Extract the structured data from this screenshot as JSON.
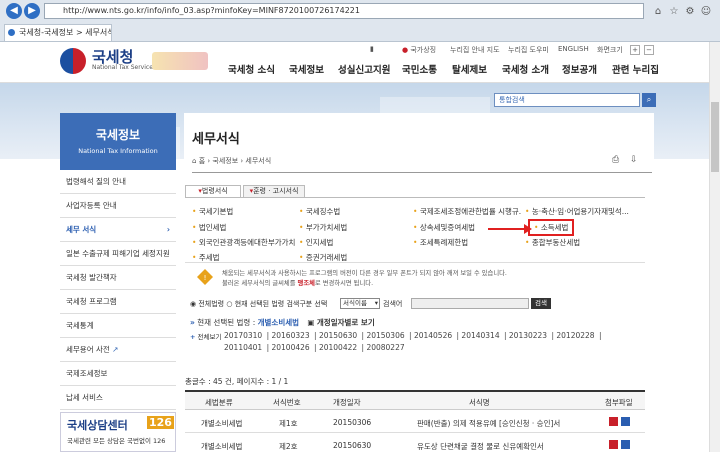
{
  "browser": {
    "url": "http://www.nts.go.kr/info/info_03.asp?minfoKey=MINF8720100726174221",
    "tab_title": "국세청-국세정보 > 세무서식..."
  },
  "header": {
    "logo_text": "국세청",
    "logo_sub": "National Tax Service",
    "util": [
      "국가상징",
      "누리집 안내 지도",
      "누리집 도우미",
      "ENGLISH",
      "화면크기"
    ],
    "zoom_plus": "+",
    "zoom_minus": "−",
    "gnb": [
      "국세청 소식",
      "국세정보",
      "성실신고지원",
      "국민소통",
      "탈세제보",
      "국세청 소개",
      "정보공개",
      "관련 누리집"
    ]
  },
  "search": {
    "placeholder": "통합검색"
  },
  "sidebar": {
    "title": "국세정보",
    "subtitle": "National Tax Information",
    "items": [
      {
        "label": "법령해석 질의 안내"
      },
      {
        "label": "사업자등록 안내"
      },
      {
        "label": "세무 서식"
      },
      {
        "label": "일본 수출규제 피해기업 세정지원"
      },
      {
        "label": "국세청 발간책자"
      },
      {
        "label": "국세청 프로그램"
      },
      {
        "label": "국세통계"
      },
      {
        "label": "세무용어 사전"
      },
      {
        "label": "국제조세정보"
      },
      {
        "label": "납세 서비스"
      }
    ],
    "banner_title": "국세상담센터",
    "banner_num": "126",
    "banner_sub": "국세관련 모든 상담은 국번없이 126"
  },
  "page": {
    "title": "세무서식",
    "breadcrumb": [
      "홈",
      "국세정보",
      "세무서식"
    ],
    "tabs": [
      "법령서식",
      "훈령 · 고시서식"
    ],
    "categories": [
      [
        "국세기본법",
        "국세징수법",
        "국제조세조정에관한법률 시행규...",
        "농·축산·임·어업용기자재및석..."
      ],
      [
        "법인세법",
        "부가가치세법",
        "상속세및증여세법",
        "소득세법"
      ],
      [
        "외국인관광객등에대한부가가치...",
        "인지세법",
        "조세특례제한법",
        "종합부동산세법"
      ],
      [
        "주세법",
        "증권거래세법",
        "",
        ""
      ]
    ],
    "notice1": "채움되는 세무서식과 사용하시는 프로그램의 버전이 다른 경우 일부 폰트가 되지 않아 깨져 보일 수 있습니다.",
    "notice2": "불러온 세무서식의 글씨체를 ",
    "notice2_em": "맹조체",
    "notice2_tail": "로 변경하시면 됩니다.",
    "filter_all": "전체법령",
    "filter_current": "현재 선택된 법령 검색구분 선택",
    "filter_select": "서식이름",
    "filter_search_label": "검색어",
    "filter_button": "검색",
    "selected_prefix": "현재 선택된 법령 :",
    "selected_law": "개별소비세법",
    "revision_link": "개정일자별로 보기",
    "view_all": "전체보기",
    "dates": [
      "20170310",
      "20160323",
      "20150630",
      "20150306",
      "20140526",
      "20140314",
      "20130223",
      "20120228",
      "20110401",
      "20100426",
      "20100422",
      "20080227"
    ],
    "total": "총글수 : 45 건, 페이지수 : 1 / 1",
    "table_headers": [
      "세법분류",
      "서식번호",
      "개정일자",
      "서식명",
      "첨부파일"
    ],
    "rows": [
      {
        "law": "개별소비세법",
        "no": "제1호",
        "date": "20150306",
        "name": "판매(반출) 의제 적용유예 [승인신청 · 승인]서"
      },
      {
        "law": "개별소비세법",
        "no": "제2호",
        "date": "20150630",
        "name": "유도상 단련채굴 결정 물로 신유예확인서"
      }
    ]
  },
  "colors": {
    "primary": "#3c6db7",
    "highlight": "#e02020",
    "link": "#2a5db0"
  }
}
